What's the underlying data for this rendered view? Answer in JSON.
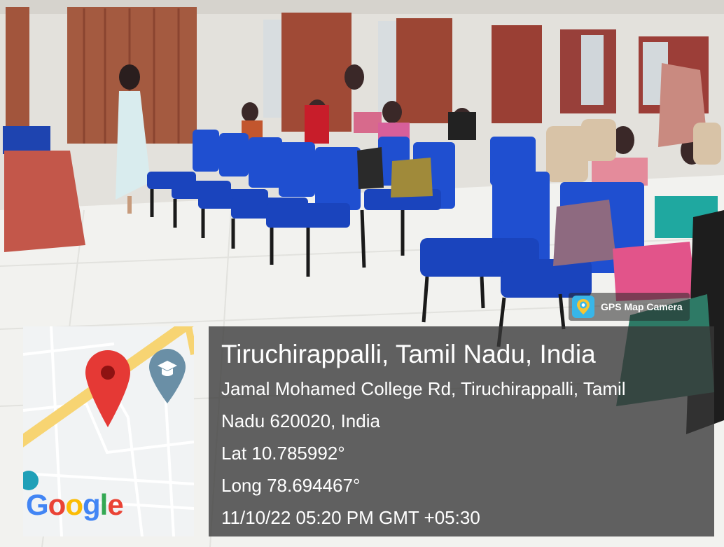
{
  "badge": {
    "app_name": "GPS Map Camera",
    "icon": "gps-map-camera-logo-icon"
  },
  "location": {
    "title": "Tiruchirappalli, Tamil Nadu, India",
    "address_line_1": "Jamal Mohamed College Rd, Tiruchirappalli, Tamil",
    "address_line_2": "Nadu 620020, India",
    "latitude": "Lat 10.785992°",
    "longitude": "Long 78.694467°",
    "datetime": "11/10/22 05:20 PM GMT +05:30"
  },
  "map": {
    "logo_text": "Google",
    "pin_icon": "location-pin-icon",
    "poi_icon": "graduation-cap-icon",
    "logo_colors": [
      "#4285F4",
      "#EA4335",
      "#FBBC05",
      "#4285F4",
      "#34A853",
      "#EA4335"
    ],
    "road_color": "#f7d472",
    "pin_color": "#e53935"
  },
  "photo": {
    "scene": "classroom-seminar-photo"
  }
}
